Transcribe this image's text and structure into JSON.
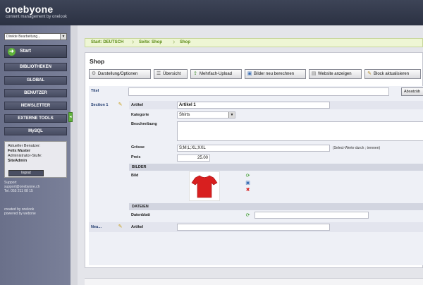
{
  "header": {
    "logo": "onebyone",
    "tagline": "content management by onelook"
  },
  "sidebar": {
    "mode_select": "Direkte Bearbeitung...",
    "start_label": "Start",
    "nav": [
      "BIBLIOTHEKEN",
      "GLOBAL",
      "BENUTZER",
      "NEWSLETTER",
      "EXTERNE TOOLS",
      "MySQL"
    ],
    "user": {
      "current_label": "Aktueller Benutzer:",
      "name": "Felix Muster",
      "level_label": "Administrator-Stufe:",
      "level": "SiteAdmin",
      "logout": "logout"
    },
    "support_title": "Support",
    "support_email": "support@onebyone.ch",
    "support_phone": "Tel. 055 211 08 15",
    "created_by": "created by onelook",
    "powered_by": "powered by webone"
  },
  "breadcrumb": [
    "Start: DEUTSCH",
    "Seite: Shop",
    "Shop"
  ],
  "panel": {
    "title": "Shop",
    "toolbar": [
      "Darstellung/Optionen",
      "Übersicht",
      "Mehrfach-Upload",
      "Bilder neu berechnen",
      "Website anzeigen",
      "Block aktualisieren"
    ]
  },
  "form": {
    "titel_label": "Titel",
    "absatz_button": "Absatzüb",
    "section_label": "Section 1",
    "artikel_label": "Artikel",
    "artikel_value": "Artikel 1",
    "kategorie_label": "Kategorie",
    "kategorie_value": "Shirts",
    "beschreibung_label": "Beschreibung",
    "groesse_label": "Grösse",
    "groesse_value": "S;M;L;XL;XXL",
    "groesse_note": "(Select-Werte durch ; trennen)",
    "preis_label": "Preis",
    "preis_value": "25.00",
    "bilder_head": "BILDER",
    "bild_label": "Bild",
    "dateien_head": "DATEIEN",
    "datenblatt_label": "Datenblatt",
    "new_section_label": "Neu...",
    "new_artikel_label": "Artikel"
  },
  "colors": {
    "header": "#2b3142",
    "sidebar": "#6a708a",
    "accent_green": "#5fb33a",
    "breadcrumb_bg": "#eef6d4",
    "shirt_red": "#d81f1f"
  }
}
